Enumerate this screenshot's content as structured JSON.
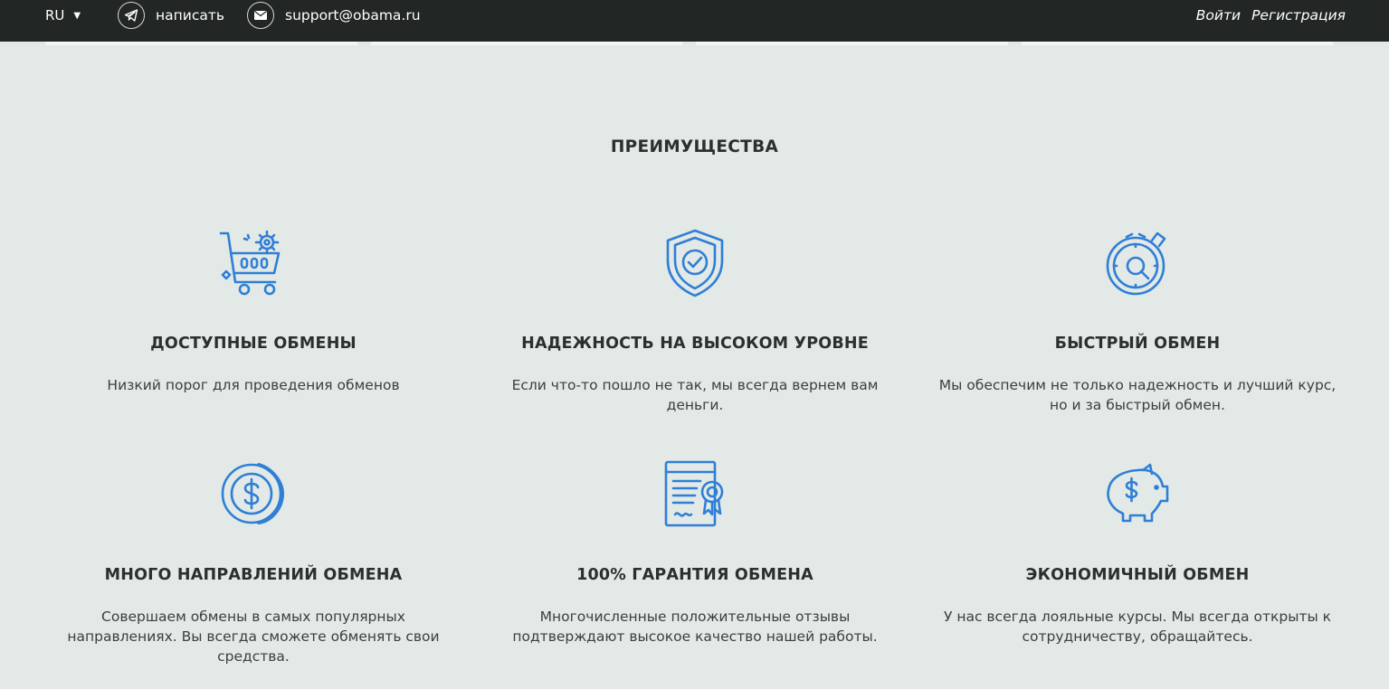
{
  "topbar": {
    "language": "RU",
    "telegram_label": "написать",
    "email_label": "support@obama.ru",
    "login": "Войти",
    "register": "Регистрация"
  },
  "advantages": {
    "heading": "ПРЕИМУЩЕСТВА",
    "items": [
      {
        "icon": "shopping-cart-icon",
        "title": "ДОСТУПНЫЕ ОБМЕНЫ",
        "description": "Низкий порог для проведения обменов"
      },
      {
        "icon": "shield-check-icon",
        "title": "НАДЕЖНОСТЬ НА ВЫСОКОМ УРОВНЕ",
        "description": "Если что-то пошло не так, мы всегда вернем вам деньги."
      },
      {
        "icon": "stopwatch-icon",
        "title": "БЫСТРЫЙ ОБМЕН",
        "description": "Мы обеспечим не только надежность и лучший курс, но и за быстрый обмен."
      },
      {
        "icon": "dollar-coin-icon",
        "title": "МНОГО НАПРАВЛЕНИЙ ОБМЕНА",
        "description": "Совершаем обмены в самых популярных направлениях. Вы всегда сможете обменять свои средства."
      },
      {
        "icon": "certificate-icon",
        "title": "100% ГАРАНТИЯ ОБМЕНА",
        "description": "Многочисленные положительные отзывы подтверждают высокое качество нашей работы."
      },
      {
        "icon": "piggy-bank-icon",
        "title": "ЭКОНОМИЧНЫЙ ОБМЕН",
        "description": "У нас всегда лояльные курсы. Мы всегда открыты к сотрудничеству, обращайтесь."
      }
    ]
  },
  "colors": {
    "accent": "#2f7fd6",
    "topbar": "#222625",
    "background": "#e3e9e7"
  }
}
